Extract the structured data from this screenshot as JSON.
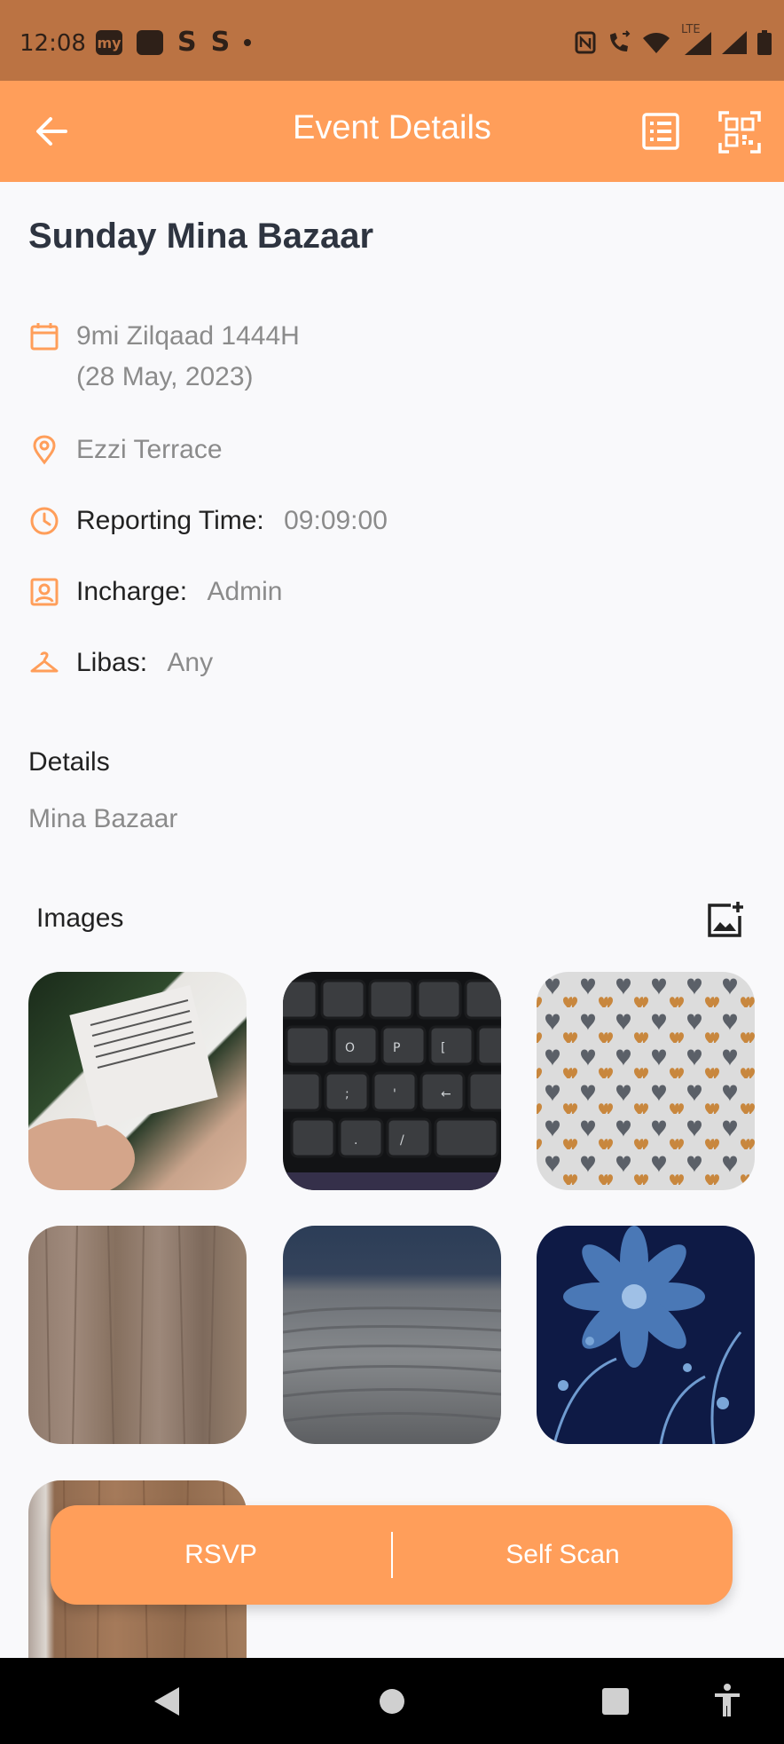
{
  "status_bar": {
    "time": "12:08",
    "left_icons": [
      "my-app-icon",
      "square-app-icon",
      "s-app-icon",
      "s-app-icon",
      "dot-icon"
    ],
    "right_icons": [
      "nfc-icon",
      "call-icon",
      "wifi-icon",
      "lte-signal-icon",
      "signal-icon",
      "battery-icon"
    ],
    "lte_label": "LTE"
  },
  "app_bar": {
    "title": "Event Details",
    "back_icon": "arrow-left-icon",
    "list_icon": "list-icon",
    "qr_icon": "qr-scan-icon"
  },
  "event": {
    "title": "Sunday Mina Bazaar",
    "date_hijri": "9mi Zilqaad 1444H",
    "date_gregorian": "(28 May, 2023)",
    "location": "Ezzi Terrace",
    "reporting_label": "Reporting Time:",
    "reporting_value": "09:09:00",
    "incharge_label": "Incharge:",
    "incharge_value": "Admin",
    "libas_label": "Libas:",
    "libas_value": "Any"
  },
  "details": {
    "label": "Details",
    "text": "Mina Bazaar"
  },
  "images": {
    "label": "Images",
    "add_icon": "add-image-icon",
    "items": [
      "product-label-photo",
      "keyboard-photo",
      "hearts-fabric-photo",
      "wood-texture-photo",
      "sand-dunes-photo",
      "blue-floral-photo",
      "wood-panel-photo"
    ]
  },
  "actions": {
    "rsvp": "RSVP",
    "self_scan": "Self Scan"
  },
  "nav_bar": {
    "icons": [
      "back-triangle-icon",
      "home-circle-icon",
      "recents-square-icon",
      "accessibility-icon"
    ]
  },
  "colors": {
    "status_bar": "#bb7343",
    "accent": "#ff9e5a",
    "title_text": "#2e3440",
    "muted_text": "#8b8b8b"
  }
}
